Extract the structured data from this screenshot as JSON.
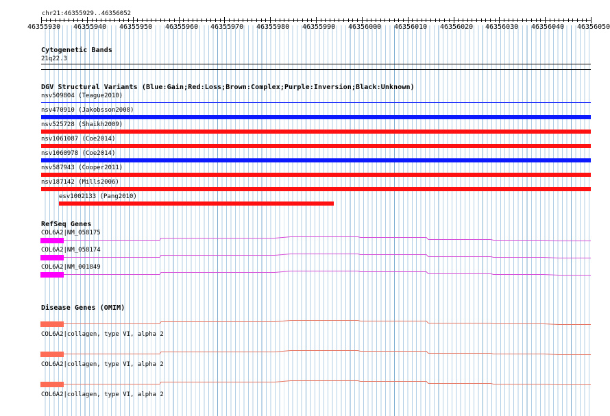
{
  "locus": {
    "label": "chr21:46355929..46356052",
    "ruler_ticks": [
      "46355930",
      "46355940",
      "46355950",
      "46355960",
      "46355970",
      "46355980",
      "46355990",
      "46356000",
      "46356010",
      "46356020",
      "46356030",
      "46356040",
      "46356050"
    ]
  },
  "cytogenetic": {
    "title": "Cytogenetic Bands",
    "band": "21q22.3"
  },
  "dgv": {
    "title": "DGV Structural Variants (Blue:Gain;Red:Loss;Brown:Complex;Purple:Inversion;Black:Unknown)",
    "items": [
      {
        "label": "nsv509804 (Teague2010)",
        "type": "thin-blue"
      },
      {
        "label": "nsv470910 (Jakobsson2008)",
        "type": "blue"
      },
      {
        "label": "nsv525728 (Shaikh2009)",
        "type": "red"
      },
      {
        "label": "nsv1061087 (Coe2014)",
        "type": "red"
      },
      {
        "label": "nsv1060978 (Coe2014)",
        "type": "blue"
      },
      {
        "label": "nsv587943 (Cooper2011)",
        "type": "red"
      },
      {
        "label": "nsv187142 (Mills2006)",
        "type": "red"
      },
      {
        "label": "esv1002133 (Pang2010)",
        "type": "red"
      }
    ]
  },
  "refseq": {
    "title": "RefSeq Genes",
    "items": [
      {
        "label": "COL6A2|NM_058175"
      },
      {
        "label": "COL6A2|NM_058174"
      },
      {
        "label": "COL6A2|NM_001849"
      }
    ]
  },
  "omim": {
    "title": "Disease Genes (OMIM)",
    "items": [
      {
        "label": "COL6A2|collagen, type VI, alpha 2"
      },
      {
        "label": "COL6A2|collagen, type VI, alpha 2"
      },
      {
        "label": "COL6A2|collagen, type VI, alpha 2"
      }
    ]
  },
  "colors": {
    "gain": "#0a19ff",
    "loss": "#ff1111",
    "refseq_block": "#ff00ff",
    "refseq_line": "#d54cd8",
    "omim_block": "#ff6c55",
    "omim_line": "#e57561",
    "grid_minor": "#8ab8d8",
    "grid_major": "#5a91be"
  }
}
